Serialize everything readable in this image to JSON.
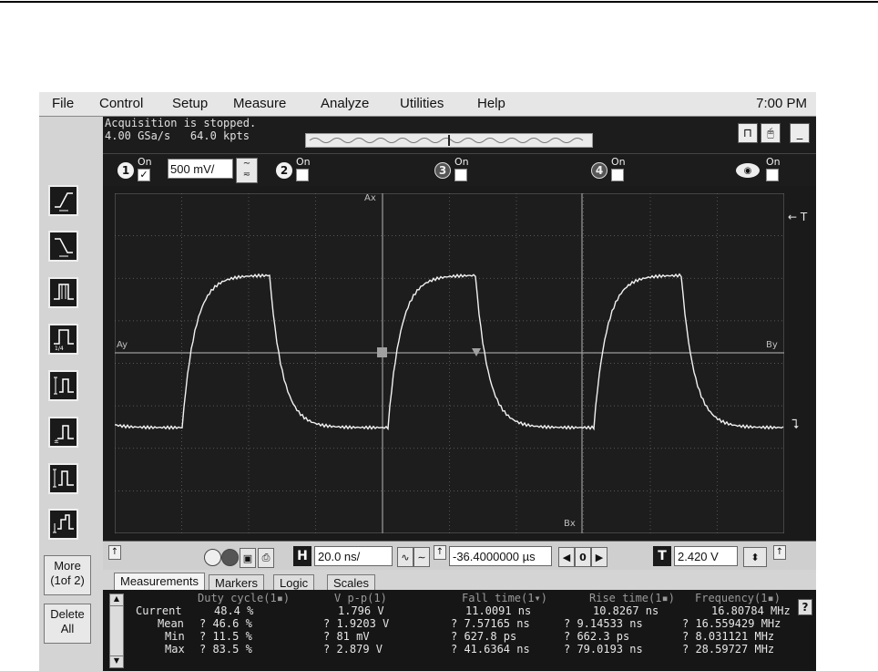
{
  "menu": {
    "items": [
      "File",
      "Control",
      "Setup",
      "Measure",
      "Analyze",
      "Utilities",
      "Help"
    ],
    "clock": "7:00 PM"
  },
  "status": {
    "line1": "Acquisition is stopped.",
    "line2": "4.00 GSa/s   64.0 kpts"
  },
  "channels": {
    "ch1": {
      "number": "1",
      "on_label": "On",
      "checked": "✓",
      "scale": "500 mV/"
    },
    "ch2": {
      "number": "2",
      "on_label": "On"
    },
    "ch3": {
      "number": "3",
      "on_label": "On"
    },
    "ch4": {
      "number": "4",
      "on_label": "On"
    },
    "math": {
      "on_label": "On"
    }
  },
  "screen": {
    "ax_label": "Ax",
    "bx_label": "Bx",
    "ay_label": "Ay",
    "by_label": "By",
    "trigger_label": "← T"
  },
  "left_toolbar": {
    "more_label": "More\n(1of 2)",
    "delete_label": "Delete\nAll"
  },
  "timebase": {
    "h_label": "H",
    "scale": "20.0 ns/",
    "delay": "-36.4000000 µs",
    "t_label": "T",
    "trigger_level": "2.420 V",
    "zero_label": "0"
  },
  "tabs": [
    "Measurements",
    "Markers",
    "Logic",
    "Scales"
  ],
  "measurements": {
    "headers": [
      "Duty cycle(1▪)",
      "V p-p(1)",
      "Fall time(1▾)",
      "Rise time(1▪)",
      "Frequency(1▪)"
    ],
    "rows": [
      {
        "label": "Current",
        "values": [
          "48.4 %",
          "1.796 V",
          "11.0091 ns",
          "10.8267 ns",
          "16.80784 MHz"
        ]
      },
      {
        "label": "Mean",
        "values": [
          "? 46.6 %",
          "? 1.9203 V",
          "? 7.57165 ns",
          "? 9.14533 ns",
          "? 16.559429 MHz"
        ]
      },
      {
        "label": "Min",
        "values": [
          "? 11.5 %",
          "? 81 mV",
          "? 627.8 ps",
          "? 662.3 ps",
          "? 8.031121 MHz"
        ]
      },
      {
        "label": "Max",
        "values": [
          "? 83.5 %",
          "? 2.879 V",
          "? 41.6364 ns",
          "? 79.0193 ns",
          "? 28.59727 MHz"
        ]
      }
    ],
    "help": "?"
  },
  "colors": {
    "screen_bg": "#1d1d1d",
    "trace": "#f2f2f2",
    "grid": "#6a6a6a",
    "panel": "#d4d4d4"
  },
  "icons": {
    "left_toolbar": [
      "rising-edge-trigger-icon",
      "falling-edge-trigger-icon",
      "pulse-width-trigger-icon",
      "pulse-width-ratio-icon",
      "rise-time-icon",
      "fall-time-icon",
      "positive-pulse-icon",
      "negative-pulse-icon"
    ]
  }
}
